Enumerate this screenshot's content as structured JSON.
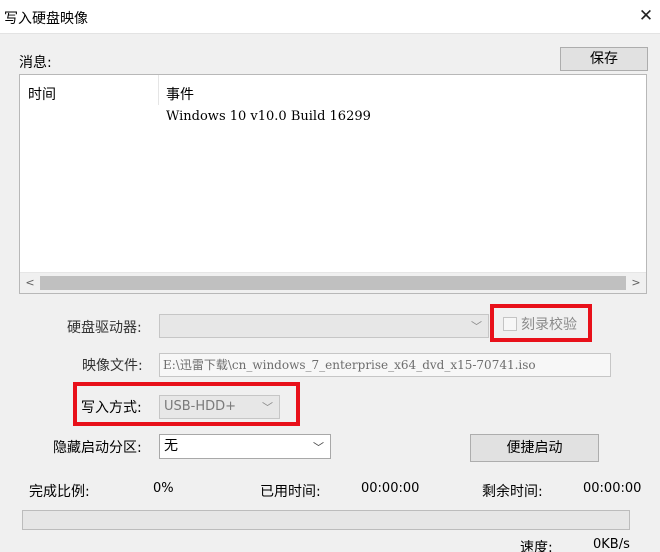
{
  "window": {
    "title": "写入硬盘映像",
    "close_glyph": "✕"
  },
  "messages": {
    "label": "消息:",
    "save_button": "保存",
    "columns": [
      "时间",
      "事件"
    ],
    "rows": [
      {
        "time": "",
        "event": "Windows 10 v10.0 Build 16299"
      }
    ],
    "scroll_left_glyph": "<",
    "scroll_right_glyph": ">"
  },
  "form": {
    "drive_label": "硬盘驱动器:",
    "drive_value": "",
    "verify_label": "刻录校验",
    "verify_checked": false,
    "image_label": "映像文件:",
    "image_value": "E:\\迅雷下载\\cn_windows_7_enterprise_x64_dvd_x15-70741.iso",
    "write_mode_label": "写入方式:",
    "write_mode_value": "USB-HDD+",
    "hidden_partition_label": "隐藏启动分区:",
    "hidden_partition_value": "无",
    "quick_boot_button": "便捷启动"
  },
  "progress": {
    "percent_label": "完成比例:",
    "percent_value": "0%",
    "elapsed_label": "已用时间:",
    "elapsed_value": "00:00:00",
    "remaining_label": "剩余时间:",
    "remaining_value": "00:00:00",
    "fraction": 0,
    "speed_label": "速度:",
    "speed_value": "0KB/s"
  },
  "icons": {
    "chevron": "﹀"
  },
  "colors": {
    "highlight_box": "#e8101a"
  }
}
